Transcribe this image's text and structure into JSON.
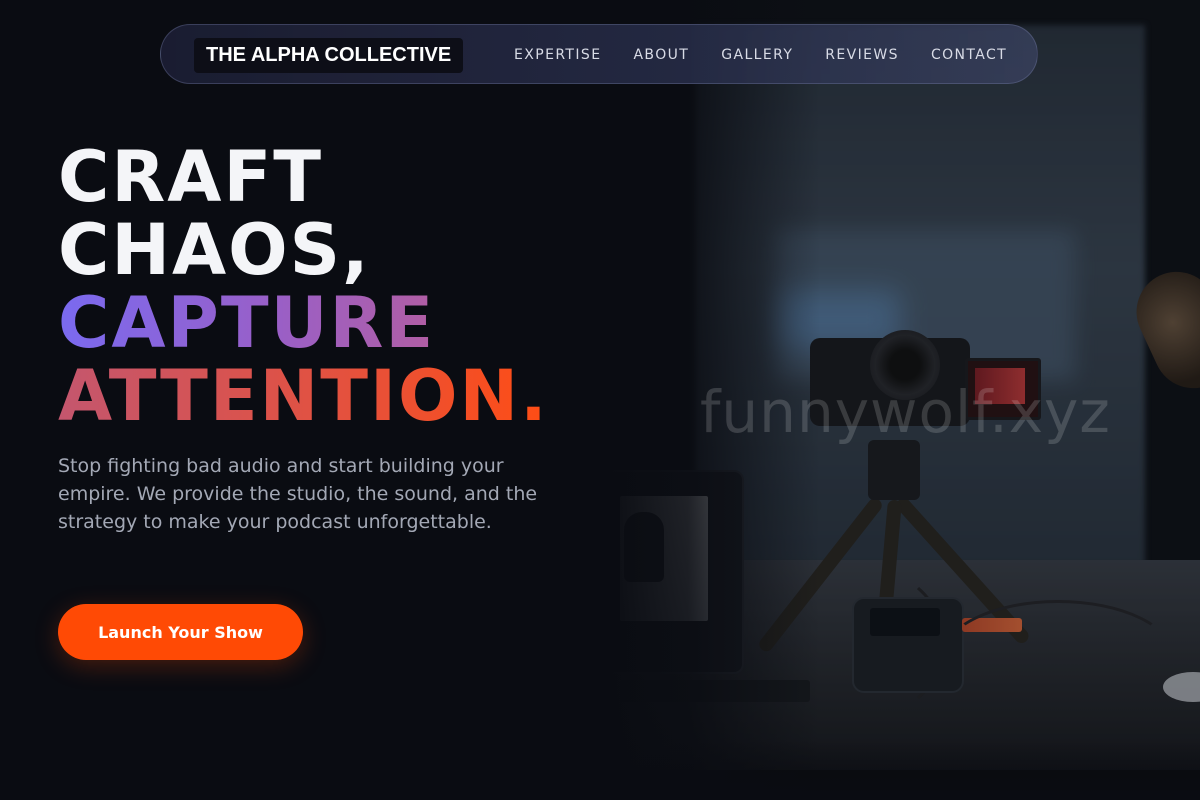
{
  "nav": {
    "brand": "THE ALPHA COLLECTIVE",
    "links": [
      {
        "label": "EXPERTISE"
      },
      {
        "label": "ABOUT"
      },
      {
        "label": "GALLERY"
      },
      {
        "label": "REVIEWS"
      },
      {
        "label": "CONTACT"
      }
    ]
  },
  "hero": {
    "title_lines": [
      "CRAFT",
      "CHAOS,",
      "CAPTURE",
      "ATTENTION."
    ],
    "description": "Stop fighting bad audio and start building your empire. We provide the studio, the sound, and the strategy to make your podcast unforgettable.",
    "cta_label": "Launch Your Show"
  },
  "watermark": "funnywolf.xyz",
  "colors": {
    "background": "#0a0c12",
    "accent": "#ff4a05",
    "gradient_purple": "#7a6af0",
    "gradient_orange": "#ff4d14",
    "body_text": "#a3a8b5"
  }
}
